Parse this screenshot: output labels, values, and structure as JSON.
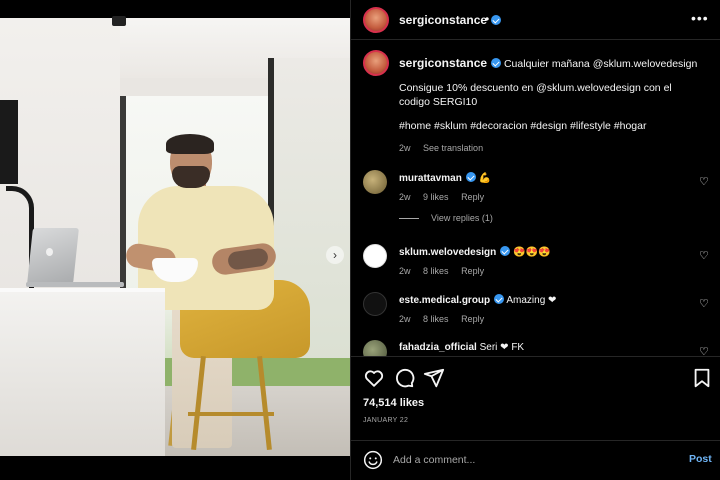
{
  "header": {
    "username": "sergiconstance",
    "separator": "•",
    "more": "•••"
  },
  "caption": {
    "username": "sergiconstance",
    "line1": "Cualquier mañana @sklum.welovedesign",
    "line2": "Consigue 10% descuento en @sklum.welovedesign con el",
    "line3": "codigo SERGI10",
    "hashtags": "#home #sklum #decoracion #design #lifestyle #hogar",
    "age": "2w",
    "see_translation": "See translation"
  },
  "comments": [
    {
      "username": "murattavman",
      "text": "💪",
      "age": "2w",
      "likes": "9 likes",
      "reply": "Reply",
      "avatar_color": "#8a7a4a"
    },
    {
      "username": "sklum.welovedesign",
      "text": "😍😍😍",
      "age": "2w",
      "likes": "8 likes",
      "reply": "Reply",
      "avatar_color": "#ffffff"
    },
    {
      "username": "este.medical.group",
      "text": "Amazing ❤",
      "age": "2w",
      "likes": "8 likes",
      "reply": "Reply",
      "avatar_color": "#111111"
    },
    {
      "username": "fahadzia_official",
      "text": "Seri ❤ FK",
      "age": "",
      "likes": "",
      "reply": "",
      "avatar_color": "#6f7a5a"
    }
  ],
  "view_replies": "View replies (1)",
  "likes_count": "74,514 likes",
  "date": "JANUARY 22",
  "add_comment": {
    "placeholder": "Add a comment...",
    "post_label": "Post"
  },
  "colors": {
    "background": "#000000",
    "verified": "#3897f0",
    "post_link": "#6fb4f5",
    "muted_text": "#a8a8a8"
  },
  "icons": [
    "more-icon",
    "heart-icon",
    "comment-icon",
    "share-icon",
    "bookmark-icon",
    "smile-icon",
    "chevron-right-icon",
    "verified-badge-icon"
  ]
}
